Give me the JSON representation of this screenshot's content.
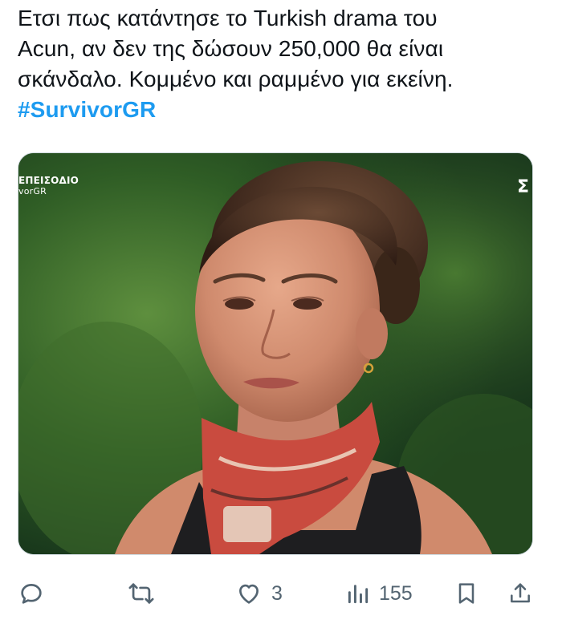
{
  "tweet": {
    "text_lines": [
      "Ετσι πως κατάντησε το Turkish drama του",
      "Acun, αν δεν της δώσουν 250,000 θα είναι",
      "σκάνδαλο. Κομμένο και ραμμένο για εκείνη."
    ],
    "hashtag": "#SurvivorGR"
  },
  "media": {
    "overlay_label": "ΕΠΕΙΣΟΔΙΟ",
    "overlay_sub": "vorGR",
    "overlay_sigma": "Σ",
    "description_icon": "photo-of-contestant"
  },
  "actions": {
    "reply": {
      "icon": "reply-icon",
      "count": ""
    },
    "retweet": {
      "icon": "retweet-icon",
      "count": ""
    },
    "like": {
      "icon": "heart-icon",
      "count": "3"
    },
    "views": {
      "icon": "views-icon",
      "count": "155"
    },
    "bookmark": {
      "icon": "bookmark-icon"
    },
    "share": {
      "icon": "share-icon"
    }
  },
  "colors": {
    "hashtag": "#1d9bf0",
    "action_gray": "#536471",
    "text": "#0f1419"
  }
}
